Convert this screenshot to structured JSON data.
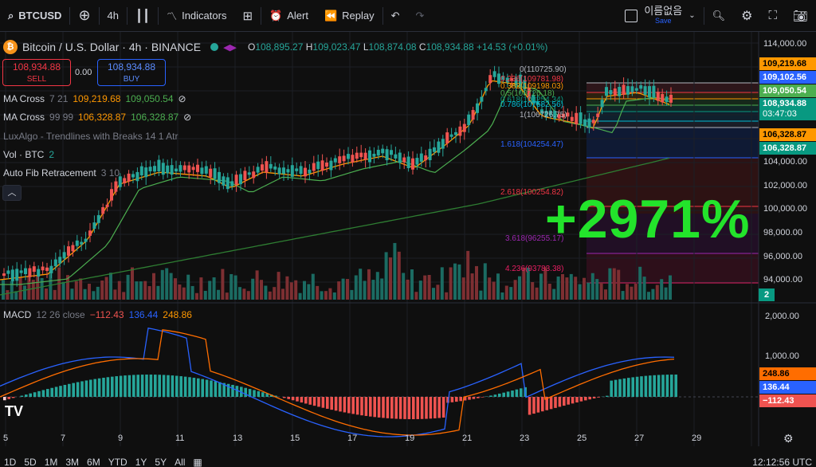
{
  "toolbar": {
    "symbol": "BTCUSD",
    "interval": "4h",
    "indicators_label": "Indicators",
    "alert_label": "Alert",
    "replay_label": "Replay",
    "layout_name": "이름없음",
    "save_label": "Save"
  },
  "header": {
    "title": "Bitcoin / U.S. Dollar · 4h · BINANCE",
    "open_label": "O",
    "open": "108,895.27",
    "high_label": "H",
    "high": "109,023.47",
    "low_label": "L",
    "low": "108,874.08",
    "close_label": "C",
    "close": "108,934.88",
    "change": "+14.53 (+0.01%)"
  },
  "trade": {
    "sell_price": "108,934.88",
    "sell_label": "SELL",
    "spread": "0.00",
    "buy_price": "108,934.88",
    "buy_label": "BUY"
  },
  "indicators": {
    "ma1_name": "MA Cross",
    "ma1_params": "7 21",
    "ma1_v1": "109,219.68",
    "ma1_v2": "109,050.54",
    "ma2_name": "MA Cross",
    "ma2_params": "99 99",
    "ma2_v1": "106,328.87",
    "ma2_v2": "106,328.87",
    "luxalgo": "LuxAlgo - Trendlines with Breaks 14 1 Atr",
    "vol_name": "Vol · BTC",
    "vol_value": "2",
    "fib_name": "Auto Fib Retracement",
    "fib_params": "3 10"
  },
  "fib_levels": [
    {
      "label": "0(110725.90)",
      "color": "#b2b5be"
    },
    {
      "label": "0.236(109781.98)",
      "color": "#f23645"
    },
    {
      "label": "0.382(109198.03)",
      "color": "#ff9800"
    },
    {
      "label": "0.5(108726.18)",
      "color": "#4caf50"
    },
    {
      "label": "0.618(108254.34)",
      "color": "#089981"
    },
    {
      "label": "0.786(107582.56)",
      "color": "#00bcd4"
    },
    {
      "label": "1(106726.75)",
      "color": "#b2b5be"
    },
    {
      "label": "1.618(104254.47)",
      "color": "#2962ff"
    },
    {
      "label": "2.618(100254.82)",
      "color": "#f23645"
    },
    {
      "label": "3.618(96255.17)",
      "color": "#9c27b0"
    },
    {
      "label": "4.236(93783.38)",
      "color": "#e91e63"
    }
  ],
  "price_axis": {
    "ticks": [
      "114,000.00",
      "104,000.00",
      "102,000.00",
      "100,000.00",
      "98,000.00",
      "96,000.00",
      "94,000.00"
    ],
    "tag_ma1": "109,219.68",
    "tag_102": "109,102.56",
    "tag_ma2": "109,050.54",
    "tag_price": "108,934.88",
    "tag_countdown": "03:47:03",
    "tag_ma99a": "106,328.87",
    "tag_ma99b": "106,328.87",
    "tag_vol": "2"
  },
  "macd": {
    "name": "MACD",
    "params": "12 26 close",
    "hist": "−112.43",
    "macd_val": "136.44",
    "signal_val": "248.86",
    "axis_ticks": [
      "2,000.00",
      "1,000.00"
    ],
    "tag_signal": "248.86",
    "tag_macd": "136.44",
    "tag_hist": "−112.43"
  },
  "time_axis": {
    "ticks": [
      "5",
      "7",
      "9",
      "11",
      "13",
      "15",
      "17",
      "19",
      "21",
      "23",
      "25",
      "27",
      "29"
    ]
  },
  "bottom": {
    "ranges": [
      "1D",
      "5D",
      "1M",
      "3M",
      "6M",
      "YTD",
      "1Y",
      "5Y",
      "All"
    ],
    "clock": "12:12:56 UTC"
  },
  "overlay": {
    "big_text": "+2971%"
  },
  "colors": {
    "up": "#26a69a",
    "down": "#ef5350",
    "ma_fast": "#ff9800",
    "ma_slow": "#4caf50",
    "macd_line": "#2962ff",
    "signal_line": "#ff6d00",
    "overlay_green": "#23e32b"
  }
}
